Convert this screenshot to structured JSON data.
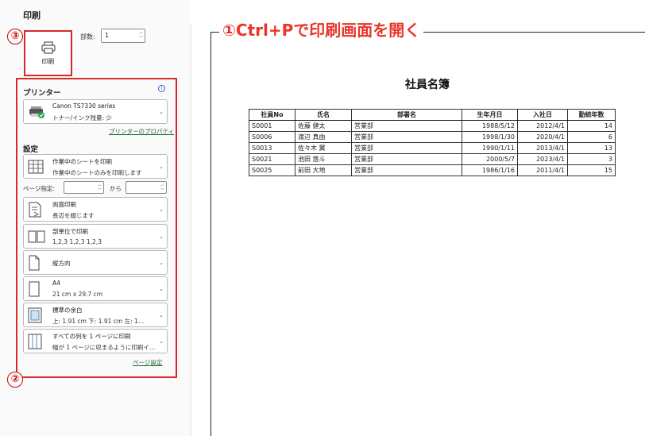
{
  "panel": {
    "title": "印刷"
  },
  "print_button": {
    "label": "印刷"
  },
  "copies": {
    "label": "部数:",
    "value": "1"
  },
  "callouts": {
    "three": "③",
    "two": "②",
    "header": "①Ctrl+Pで印刷画面を開く"
  },
  "printer": {
    "section_title": "プリンター",
    "info_glyph": "i",
    "name": "Canon TS7330 series",
    "status": "トナー/インク残量: 少",
    "properties_link": "プリンターのプロパティ"
  },
  "settings": {
    "section_title": "設定",
    "what_to_print": {
      "line1": "作業中のシートを印刷",
      "line2": "作業中のシートのみを印刷します"
    },
    "page_range": {
      "label": "ページ指定:",
      "to_label": "から",
      "from_value": "",
      "to_value": ""
    },
    "duplex": {
      "line1": "両面印刷",
      "line2": "長辺を綴じます"
    },
    "collate": {
      "line1": "部単位で印刷",
      "line2": "1,2,3    1,2,3    1,2,3"
    },
    "orientation": {
      "line1": "縦方向"
    },
    "paper": {
      "line1": "A4",
      "line2": "21 cm x 29.7 cm"
    },
    "margins": {
      "line1": "標準の余白",
      "line2": "上: 1.91 cm 下: 1.91 cm 左: 1…"
    },
    "scaling": {
      "line1": "すべての列を 1 ページに印刷",
      "line2": "幅が 1 ページに収まるように印刷イ…"
    },
    "page_setup_link": "ページ設定"
  },
  "preview": {
    "title": "社員名簿",
    "columns": [
      "社員No",
      "氏名",
      "部署名",
      "生年月日",
      "入社日",
      "勤続年数"
    ],
    "rows": [
      [
        "S0001",
        "佐藤 健太",
        "営業部",
        "1988/5/12",
        "2012/4/1",
        "14"
      ],
      [
        "S0006",
        "渡辺 真由",
        "営業部",
        "1998/1/30",
        "2020/4/1",
        "6"
      ],
      [
        "S0013",
        "佐々木 翼",
        "営業部",
        "1990/1/11",
        "2013/4/1",
        "13"
      ],
      [
        "S0021",
        "池田 悠斗",
        "営業部",
        "2000/5/7",
        "2023/4/1",
        "3"
      ],
      [
        "S0025",
        "前田 大地",
        "営業部",
        "1986/1/16",
        "2011/4/1",
        "15"
      ]
    ]
  }
}
